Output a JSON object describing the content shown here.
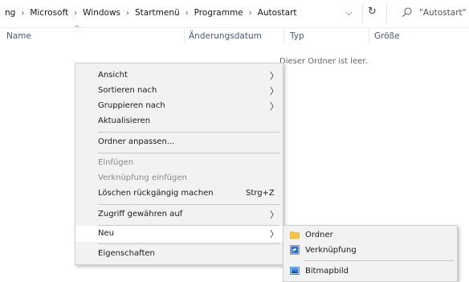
{
  "breadcrumb": [
    "ng",
    "Microsoft",
    "Windows",
    "Startmenü",
    "Programme",
    "Autostart"
  ],
  "search": {
    "placeholder": "\"Autostart\" d"
  },
  "columns": {
    "name": "Name",
    "modified": "Änderungsdatum",
    "type": "Typ",
    "size": "Größe"
  },
  "empty_message": "Dieser Ordner ist leer.",
  "context_menu": {
    "view": "Ansicht",
    "sort_by": "Sortieren nach",
    "group_by": "Gruppieren nach",
    "refresh": "Aktualisieren",
    "customize": "Ordner anpassen...",
    "paste": "Einfügen",
    "paste_shortcut": "Verknüpfung einfügen",
    "undo_delete": "Löschen rückgängig machen",
    "undo_shortcut_key": "Strg+Z",
    "give_access": "Zugriff gewähren auf",
    "new": "Neu",
    "properties": "Eigenschaften"
  },
  "new_submenu": {
    "folder": "Ordner",
    "shortcut": "Verknüpfung",
    "bitmap": "Bitmapbild"
  },
  "icons": {
    "address_dropdown": "chevron-down-icon",
    "refresh": "refresh-icon",
    "search": "search-icon",
    "submenu_arrow": "chevron-right-icon",
    "folder": "folder-icon",
    "shortcut": "shortcut-icon",
    "bitmap": "bitmap-icon"
  },
  "colors": {
    "header_text": "#4a5a7a",
    "menu_bg": "#f2f2f2",
    "hover_bg": "#ffffff",
    "folder": "#f5c542"
  }
}
